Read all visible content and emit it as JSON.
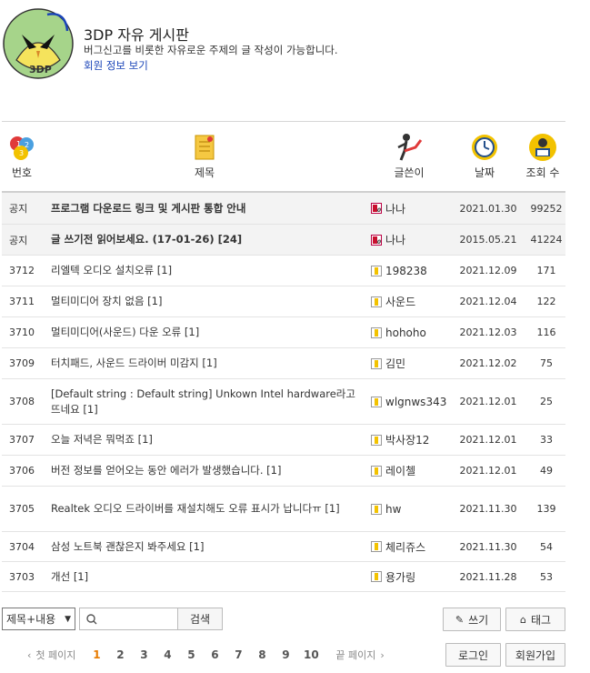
{
  "header": {
    "logo_text": "3DP",
    "title": "3DP 자유 게시판",
    "description": "버그신고를 비롯한 자유로운 주제의 글 작성이 가능합니다.",
    "member_link": "회원 정보 보기"
  },
  "columns": {
    "no": "번호",
    "title": "제목",
    "writer": "글쓴이",
    "date": "날짜",
    "views": "조회 수"
  },
  "rows": [
    {
      "no": "공지",
      "title": "프로그램 다운로드 링크 및 게시판 통합 안내",
      "writer": "나나",
      "date": "2021.01.30",
      "views": "99252"
    },
    {
      "no": "공지",
      "title": "글 쓰기전 읽어보세요. (17-01-26) [24]",
      "writer": "나나",
      "date": "2015.05.21",
      "views": "41224"
    },
    {
      "no": "3712",
      "title": "리엘텍 오디오 설치오류 [1]",
      "writer": "198238",
      "date": "2021.12.09",
      "views": "171"
    },
    {
      "no": "3711",
      "title": "멀티미디어 장치 없음 [1]",
      "writer": "사운드",
      "date": "2021.12.04",
      "views": "122"
    },
    {
      "no": "3710",
      "title": "멀티미디어(사운드) 다운 오류 [1]",
      "writer": "hohoho",
      "date": "2021.12.03",
      "views": "116"
    },
    {
      "no": "3709",
      "title": "터치패드, 사운드 드라이버 미감지 [1]",
      "writer": "김민",
      "date": "2021.12.02",
      "views": "75"
    },
    {
      "no": "3708",
      "title": "[Default string : Default string] Unkown Intel hardware라고 뜨네요 [1]",
      "writer": "wlgnws343",
      "date": "2021.12.01",
      "views": "25"
    },
    {
      "no": "3707",
      "title": "오늘 저녁은 뭐먹죠 [1]",
      "writer": "박사장12",
      "date": "2021.12.01",
      "views": "33"
    },
    {
      "no": "3706",
      "title": "버전 정보를 얻어오는 동안 에러가 발생했습니다. [1]",
      "writer": "레이첼",
      "date": "2021.12.01",
      "views": "49"
    },
    {
      "no": "3705",
      "title": "Realtek 오디오 드라이버를 재설치해도 오류 표시가 납니다ㅠ [1]",
      "writer": "hw",
      "date": "2021.11.30",
      "views": "139"
    },
    {
      "no": "3704",
      "title": "삼성 노트북 괜찮은지 봐주세요 [1]",
      "writer": "체리쥬스",
      "date": "2021.11.30",
      "views": "54"
    },
    {
      "no": "3703",
      "title": "개선 [1]",
      "writer": "용가링",
      "date": "2021.11.28",
      "views": "53"
    }
  ],
  "search": {
    "select_value": "제목+내용",
    "placeholder": "",
    "button": "검색"
  },
  "actions": {
    "write": "쓰기",
    "tag": "태그",
    "login": "로그인",
    "signup": "회원가입"
  },
  "pagination": {
    "first": "첫 페이지",
    "last": "끝 페이지",
    "pages": [
      "1",
      "2",
      "3",
      "4",
      "5",
      "6",
      "7",
      "8",
      "9",
      "10"
    ],
    "current": "1"
  },
  "colors": {
    "accent": "#e87b00",
    "link": "#1a44b8",
    "notice_bg": "#f3f3f3"
  }
}
